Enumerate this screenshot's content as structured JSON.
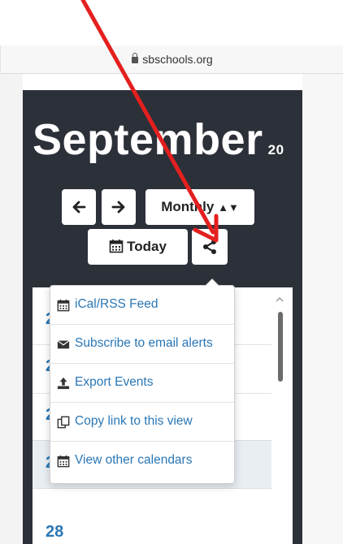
{
  "browser": {
    "url": "sbschools.org"
  },
  "calendar": {
    "month": "September",
    "year_partial": "20",
    "view_label": "Monthly",
    "today_label": "Today",
    "days": [
      "2",
      "2",
      "2",
      "2",
      "28"
    ]
  },
  "share_menu": {
    "items": [
      {
        "label": "iCal/RSS Feed",
        "icon": "calendar-icon"
      },
      {
        "label": "Subscribe to email alerts",
        "icon": "envelope-icon"
      },
      {
        "label": "Export Events",
        "icon": "upload-icon"
      },
      {
        "label": "Copy link to this view",
        "icon": "copy-icon"
      },
      {
        "label": "View other calendars",
        "icon": "calendar-icon"
      }
    ]
  },
  "colors": {
    "panel": "#2c3038",
    "link": "#2a77b5",
    "annotation_arrow": "#e3201f"
  }
}
